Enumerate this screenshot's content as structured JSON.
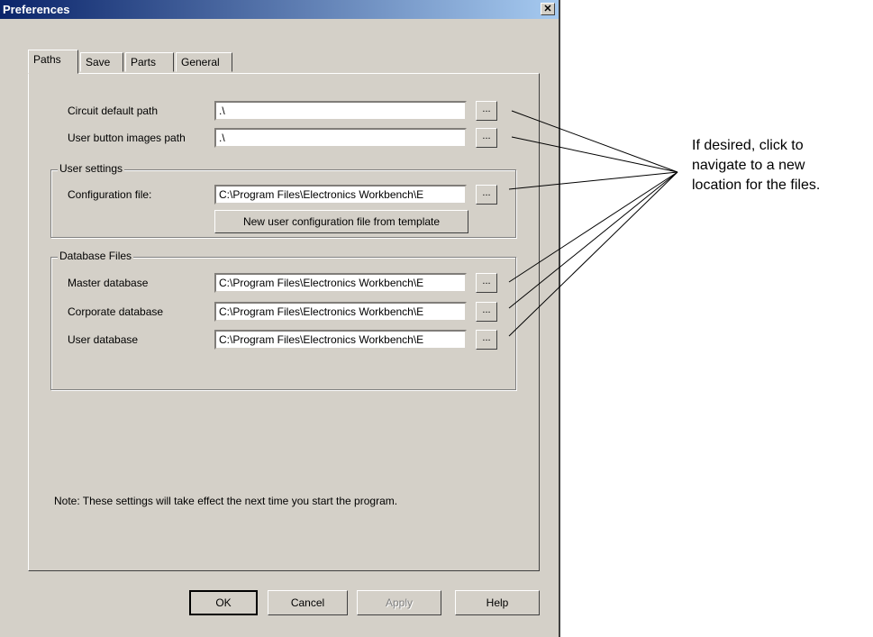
{
  "window": {
    "title": "Preferences",
    "close_glyph": "✕"
  },
  "tabs": [
    "Paths",
    "Save",
    "Parts",
    "General"
  ],
  "paths": {
    "circuit_label": "Circuit default path",
    "circuit_value": ".\\",
    "user_button_label": "User button images path",
    "user_button_value": ".\\"
  },
  "user_settings": {
    "legend": "User settings",
    "config_label": "Configuration file:",
    "config_value": "C:\\Program Files\\Electronics Workbench\\E",
    "new_config_button": "New user configuration file from template"
  },
  "database_files": {
    "legend": "Database Files",
    "master_label": "Master database",
    "master_value": "C:\\Program Files\\Electronics Workbench\\E",
    "corporate_label": "Corporate database",
    "corporate_value": "C:\\Program Files\\Electronics Workbench\\E",
    "user_label": "User database",
    "user_value": "C:\\Program Files\\Electronics Workbench\\E"
  },
  "browse_button_label": "...",
  "note": "Note:  These settings will take effect the next time you start the program.",
  "buttons": {
    "ok": "OK",
    "cancel": "Cancel",
    "apply": "Apply",
    "help": "Help"
  },
  "callout": {
    "line1": "If desired, click to",
    "line2": "navigate to a new",
    "line3": "location for the files."
  }
}
